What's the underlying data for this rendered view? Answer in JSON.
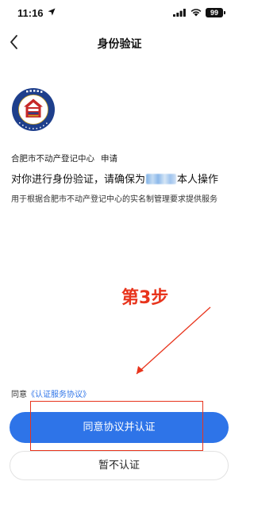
{
  "status_bar": {
    "time": "11:16",
    "battery": "99"
  },
  "header": {
    "title": "身份验证"
  },
  "logo": {
    "text_top": "不动产登记",
    "text_bottom": "Real Estate Registration"
  },
  "content": {
    "requester_name": "合肥市不动产登记中心",
    "requester_action": "申请",
    "main_prefix": "对你进行身份验证，请确保为",
    "main_suffix": "本人操作",
    "sub_text": "用于根据合肥市不动产登记中心的实名制管理要求提供服务"
  },
  "annotation": {
    "label": "第3步",
    "color": "#e8341c"
  },
  "agreement": {
    "prefix": "同意",
    "link": "《认证服务协议》"
  },
  "buttons": {
    "primary": "同意协议并认证",
    "secondary": "暂不认证"
  },
  "colors": {
    "accent": "#2e74e8",
    "annotation": "#e8341c"
  }
}
